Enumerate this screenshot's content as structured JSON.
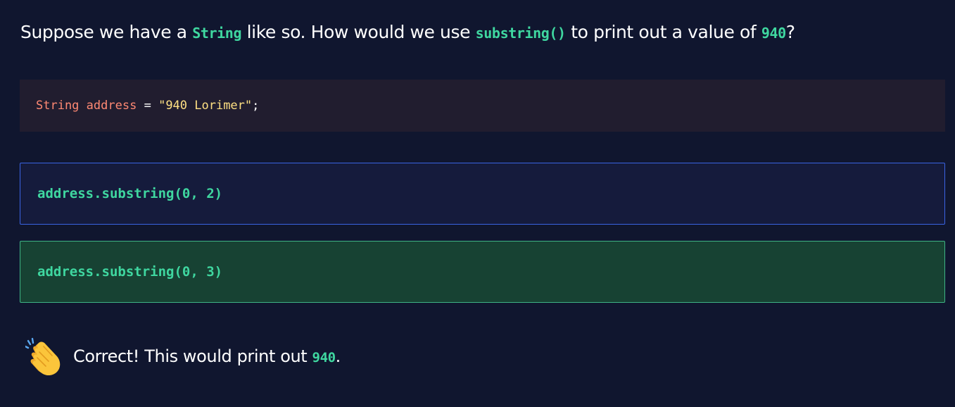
{
  "question": {
    "part1": "Suppose we have a ",
    "code1": "String",
    "part2": " like so. How would we use ",
    "code2": "substring()",
    "part3": " to print out a value of ",
    "code3": "940",
    "part4": "?"
  },
  "code_block": {
    "type": "String",
    "variable": "address",
    "operator": "=",
    "value": "\"940 Lorimer\"",
    "terminator": ";"
  },
  "options": [
    {
      "code": "address.substring(0, 2)",
      "state": "selected"
    },
    {
      "code": "address.substring(0, 3)",
      "state": "correct"
    }
  ],
  "feedback": {
    "icon": "clapping-hands-icon",
    "text": "Correct! This would print out ",
    "code": "940",
    "end": "."
  },
  "colors": {
    "background": "#10162f",
    "code_accent": "#3fd7a0",
    "selected_border": "#3a64e4",
    "correct_border": "#3fb385",
    "correct_fill": "#174233"
  }
}
